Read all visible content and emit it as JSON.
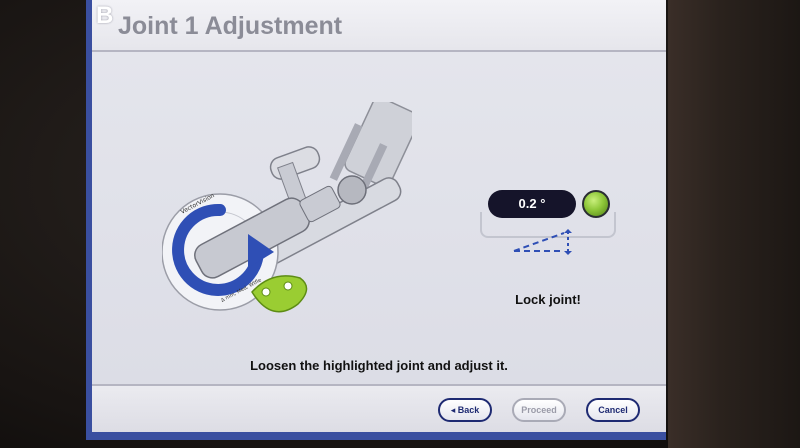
{
  "header": {
    "step_letter": "B",
    "title": "Joint 1 Adjustment"
  },
  "illustration": {
    "label_brand": "VectorVision",
    "label_small": "Δ mm, Med, Wtfle"
  },
  "readout": {
    "angle_value": "0.2 °",
    "status_color": "#8fc83a",
    "status": "Lock joint!"
  },
  "instruction": "Loosen the highlighted joint and adjust it.",
  "footer": {
    "back_label": "◂ Back",
    "proceed_label": "Proceed",
    "cancel_label": "Cancel"
  },
  "colors": {
    "frame_border": "#3a4fa0",
    "button_blue": "#1e2a72",
    "highlight_green": "#9acd32",
    "rotation_arrow": "#2f4fb5"
  }
}
